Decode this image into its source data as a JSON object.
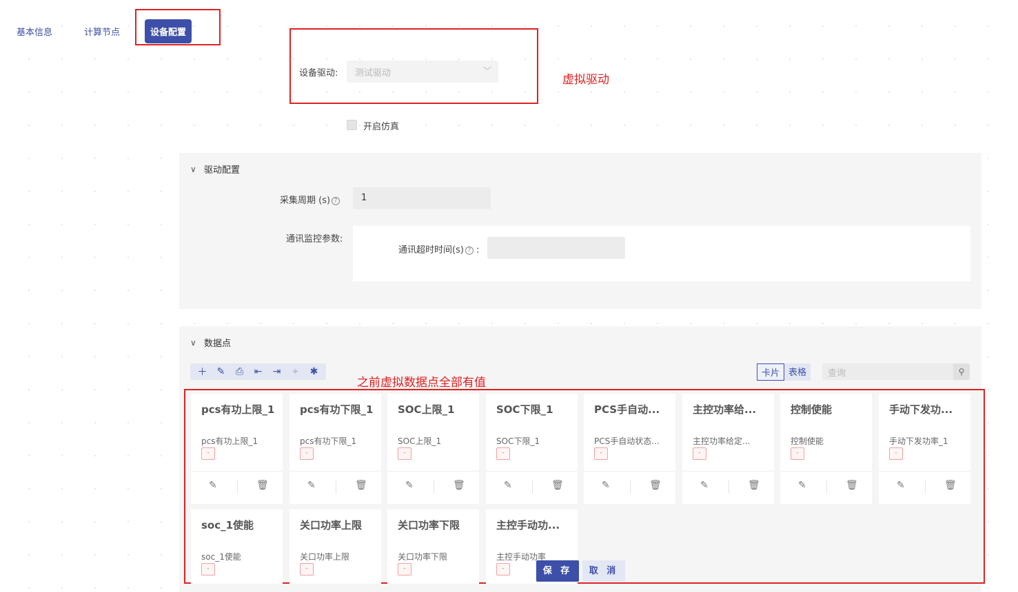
{
  "tabs": [
    {
      "label": "基本信息"
    },
    {
      "label": "计算节点"
    },
    {
      "label": "设备配置"
    }
  ],
  "driver": {
    "label": "设备驱动:",
    "value": "测试驱动",
    "annotation": "虚拟驱动"
  },
  "simulation": {
    "label": "开启仿真"
  },
  "driver_config": {
    "title": "驱动配置",
    "period_label": "采集周期 (s)",
    "period_value": "1",
    "monitor_label": "通讯监控参数:",
    "timeout_label": "通讯超时时间(s)",
    "timeout_value": ""
  },
  "data_points": {
    "title": "数据点",
    "annotation": "之前虚拟数据点全部有值",
    "view_card": "卡片",
    "view_table": "表格",
    "search_placeholder": "查询",
    "cards": [
      {
        "title": "pcs有功上限_1",
        "sub": "pcs有功上限_1",
        "value": "-"
      },
      {
        "title": "pcs有功下限_1",
        "sub": "pcs有功下限_1",
        "value": "-"
      },
      {
        "title": "SOC上限_1",
        "sub": "SOC上限_1",
        "value": "-"
      },
      {
        "title": "SOC下限_1",
        "sub": "SOC下限_1",
        "value": "-"
      },
      {
        "title": "PCS手自动...",
        "sub": "PCS手自动状态...",
        "value": "-"
      },
      {
        "title": "主控功率给...",
        "sub": "主控功率给定...",
        "value": "-"
      },
      {
        "title": "控制使能",
        "sub": "控制使能",
        "value": "-"
      },
      {
        "title": "手动下发功...",
        "sub": "手动下发功率_1",
        "value": "-"
      },
      {
        "title": "soc_1使能",
        "sub": "soc_1使能",
        "value": "-"
      },
      {
        "title": "关口功率上限",
        "sub": "关口功率上限",
        "value": "-"
      },
      {
        "title": "关口功率下限",
        "sub": "关口功率下限",
        "value": "-"
      },
      {
        "title": "主控手动功...",
        "sub": "主控手动功率",
        "value": "-"
      }
    ]
  },
  "actions": {
    "save": "保 存",
    "cancel": "取 消"
  },
  "colors": {
    "primary": "#3d4fa8",
    "annotation": "#e02020"
  }
}
